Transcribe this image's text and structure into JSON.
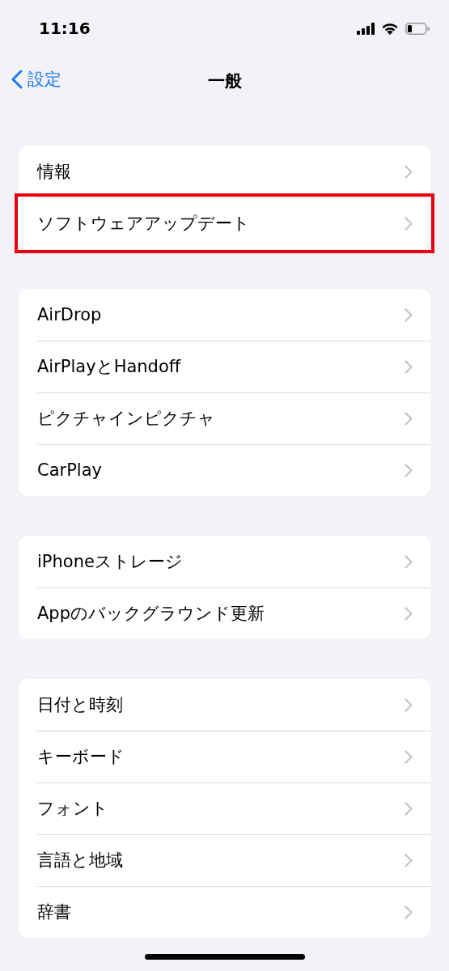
{
  "status_bar": {
    "time": "11:16"
  },
  "nav": {
    "back": "設定",
    "title": "一般"
  },
  "groups": [
    {
      "rows": [
        {
          "label": "情報",
          "highlighted": false
        },
        {
          "label": "ソフトウェアアップデート",
          "highlighted": true
        }
      ]
    },
    {
      "rows": [
        {
          "label": "AirDrop"
        },
        {
          "label": "AirPlayとHandoff"
        },
        {
          "label": "ピクチャインピクチャ"
        },
        {
          "label": "CarPlay"
        }
      ]
    },
    {
      "rows": [
        {
          "label": "iPhoneストレージ"
        },
        {
          "label": "Appのバックグラウンド更新"
        }
      ]
    },
    {
      "rows": [
        {
          "label": "日付と時刻"
        },
        {
          "label": "キーボード"
        },
        {
          "label": "フォント"
        },
        {
          "label": "言語と地域"
        },
        {
          "label": "辞書"
        }
      ]
    }
  ]
}
